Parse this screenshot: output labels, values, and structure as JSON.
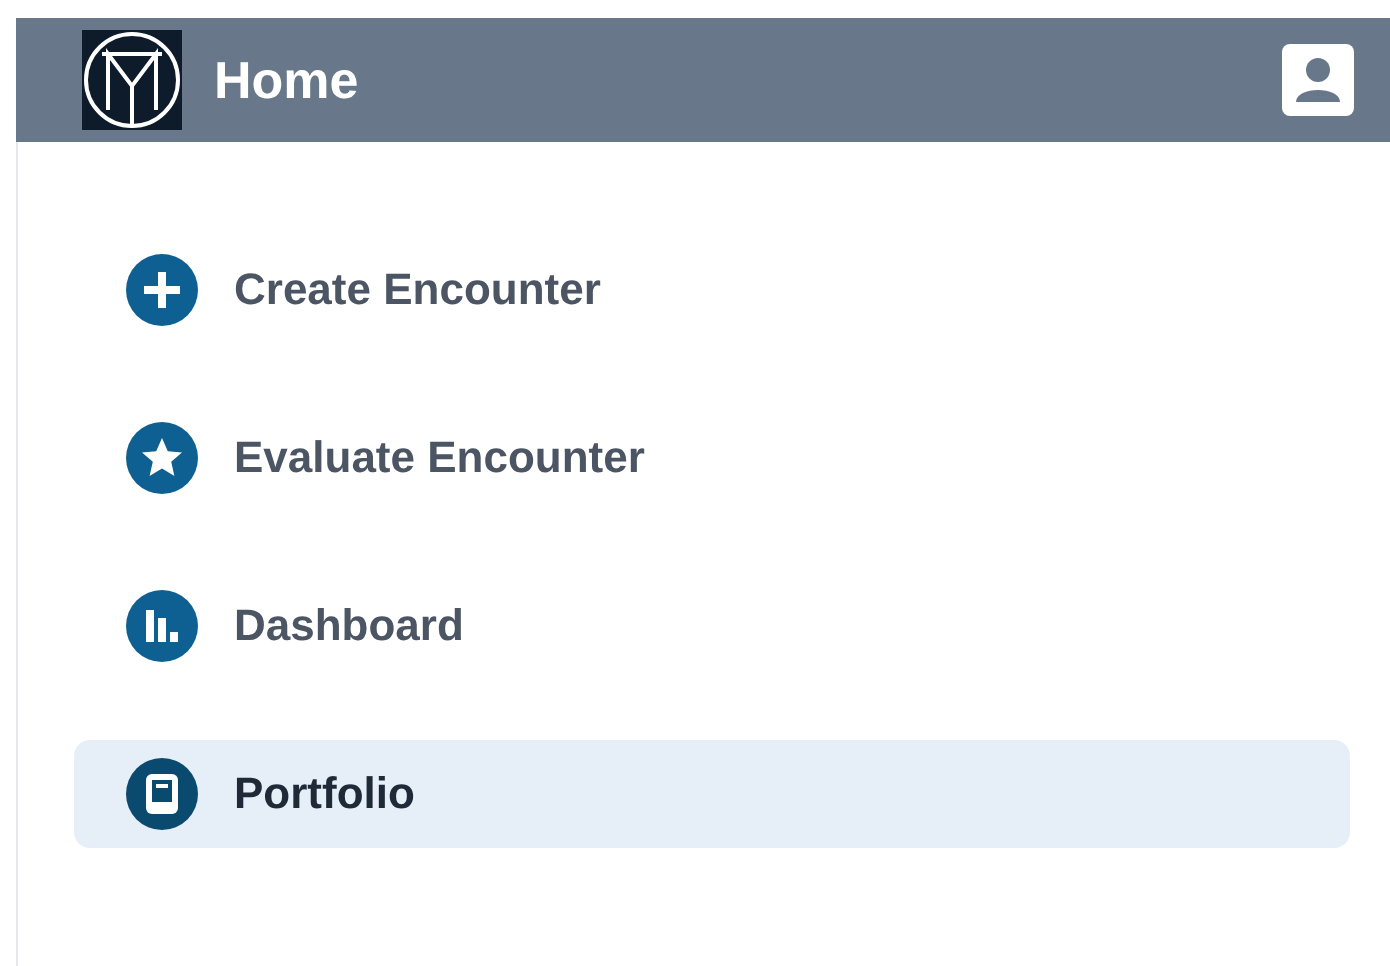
{
  "header": {
    "title": "Home"
  },
  "nav": [
    {
      "label": "Create Encounter",
      "kind": "plus",
      "selected": false
    },
    {
      "label": "Evaluate Encounter",
      "kind": "star",
      "selected": false
    },
    {
      "label": "Dashboard",
      "kind": "chart",
      "selected": false
    },
    {
      "label": "Portfolio",
      "kind": "book",
      "selected": true
    }
  ]
}
